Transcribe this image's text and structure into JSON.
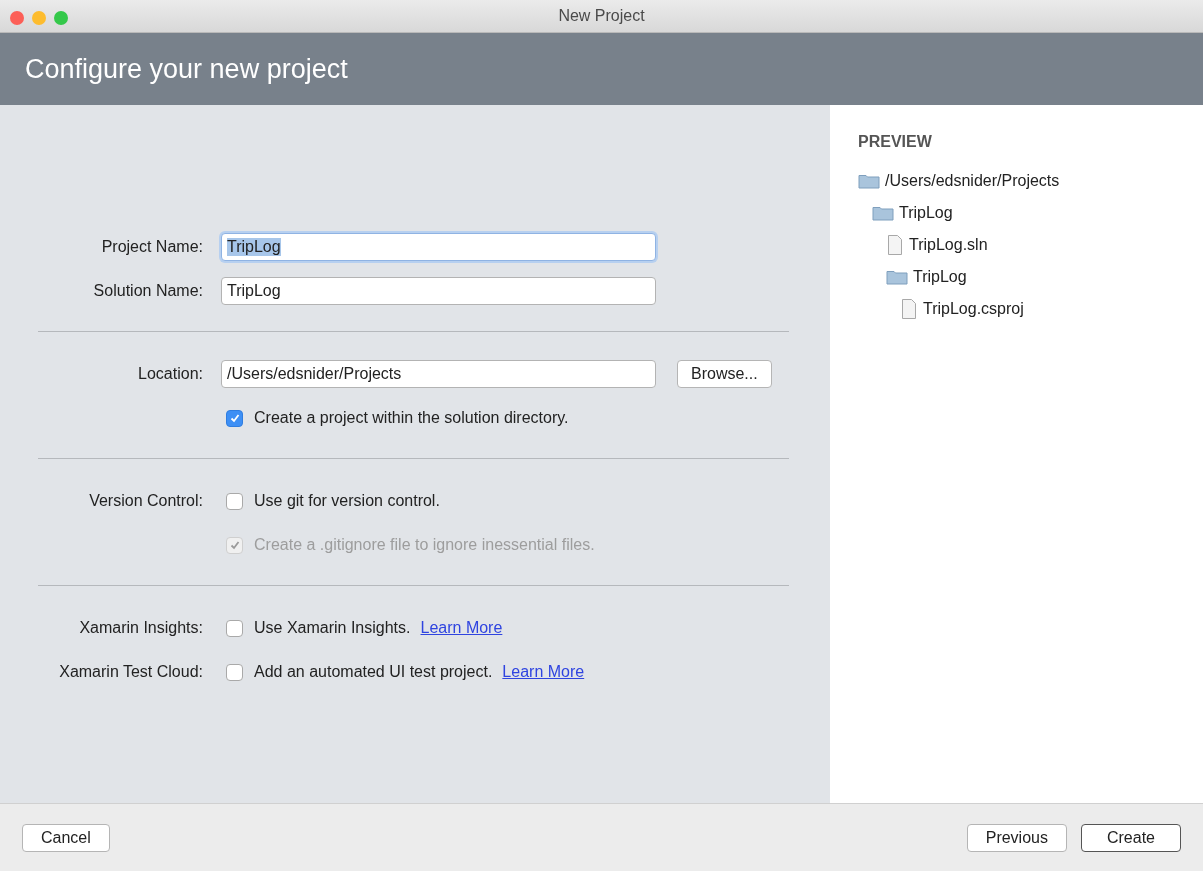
{
  "window": {
    "title": "New Project"
  },
  "header": {
    "title": "Configure your new project"
  },
  "sections": [
    {
      "rows": [
        {
          "kind": "field",
          "label": "Project Name:",
          "value": "TripLog",
          "text_selected": true
        },
        {
          "kind": "field",
          "label": "Solution Name:",
          "value": "TripLog",
          "text_selected": false
        }
      ]
    },
    {
      "rows": [
        {
          "kind": "field-button",
          "label": "Location:",
          "value": "/Users/edsnider/Projects",
          "button": "Browse..."
        },
        {
          "kind": "checkbox",
          "text": "Create a project within the solution directory.",
          "checked": true,
          "disabled": false
        }
      ]
    },
    {
      "rows": [
        {
          "kind": "checkbox",
          "label": "Version Control:",
          "text": "Use git for version control.",
          "checked": false,
          "disabled": false
        },
        {
          "kind": "checkbox",
          "text": "Create a .gitignore file to ignore inessential files.",
          "checked": true,
          "disabled": true
        }
      ]
    },
    {
      "rows": [
        {
          "kind": "checkbox",
          "label": "Xamarin Insights:",
          "text": "Use Xamarin Insights.",
          "checked": false,
          "disabled": false,
          "link": "Learn More"
        },
        {
          "kind": "checkbox",
          "label": "Xamarin Test Cloud:",
          "text": "Add an automated UI test project.",
          "checked": false,
          "disabled": false,
          "link": "Learn More"
        }
      ]
    }
  ],
  "preview": {
    "title": "PREVIEW",
    "tree": [
      {
        "kind": "folder",
        "name": "/Users/edsnider/Projects",
        "children": [
          {
            "kind": "folder",
            "name": "TripLog",
            "children": [
              {
                "kind": "file",
                "name": "TripLog.sln"
              },
              {
                "kind": "folder",
                "name": "TripLog",
                "children": [
                  {
                    "kind": "file",
                    "name": "TripLog.csproj"
                  }
                ]
              }
            ]
          }
        ]
      }
    ]
  },
  "footer": {
    "left_buttons": [
      {
        "label": "Cancel",
        "default": false
      }
    ],
    "right_buttons": [
      {
        "label": "Previous",
        "default": false
      },
      {
        "label": "Create",
        "default": true
      }
    ]
  }
}
